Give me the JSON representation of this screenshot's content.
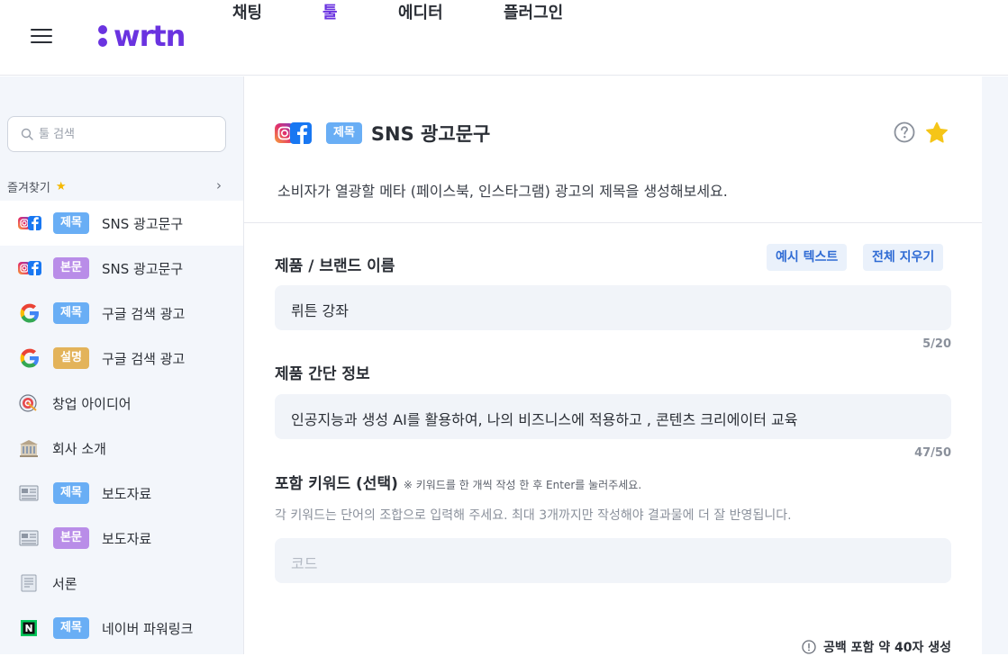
{
  "header": {
    "logo_text": "wrtn",
    "nav": [
      {
        "label": "채팅",
        "active": false
      },
      {
        "label": "툴",
        "active": true
      },
      {
        "label": "에디터",
        "active": false
      },
      {
        "label": "플러그인",
        "active": false
      }
    ]
  },
  "sidebar": {
    "search_placeholder": "툴 검색",
    "favorites_label": "즐겨찾기",
    "items": [
      {
        "icon": "instagram-facebook-icon",
        "badge": "제목",
        "badge_color": "#69aef5",
        "label": "SNS 광고문구",
        "selected": true
      },
      {
        "icon": "instagram-facebook-icon",
        "badge": "본문",
        "badge_color": "#b98de8",
        "label": "SNS 광고문구",
        "selected": false
      },
      {
        "icon": "google-icon",
        "badge": "제목",
        "badge_color": "#69aef5",
        "label": "구글 검색 광고",
        "selected": false
      },
      {
        "icon": "google-icon",
        "badge": "설명",
        "badge_color": "#e3b35a",
        "label": "구글 검색 광고",
        "selected": false
      },
      {
        "icon": "target-icon",
        "badge": "",
        "label": "창업 아이디어",
        "selected": false
      },
      {
        "icon": "building-icon",
        "badge": "",
        "label": "회사 소개",
        "selected": false
      },
      {
        "icon": "newspaper-icon",
        "badge": "제목",
        "badge_color": "#69aef5",
        "label": "보도자료",
        "selected": false
      },
      {
        "icon": "newspaper-icon",
        "badge": "본문",
        "badge_color": "#b98de8",
        "label": "보도자료",
        "selected": false
      },
      {
        "icon": "document-icon",
        "badge": "",
        "label": "서론",
        "selected": false
      },
      {
        "icon": "naver-icon",
        "badge": "제목",
        "badge_color": "#69aef5",
        "label": "네이버 파워링크",
        "selected": false
      }
    ]
  },
  "main": {
    "title_badge": "제목",
    "title": "SNS 광고문구",
    "description": "소비자가 열광할 메타 (페이스북, 인스타그램) 광고의 제목을 생성해보세요.",
    "example_button": "예시 텍스트",
    "clear_button": "전체 지우기",
    "fields": {
      "brand": {
        "label": "제품 / 브랜드 이름",
        "value": "뤼튼 강좌",
        "counter": "5/20"
      },
      "info": {
        "label": "제품 간단 정보",
        "value": "인공지능과 생성 AI를 활용하여, 나의 비즈니스에 적용하고 , 콘텐츠 크리에이터 교육",
        "counter": "47/50"
      },
      "keywords": {
        "label": "포함 키워드 (선택)",
        "note": "※ 키워드를 한 개씩 작성 한 후 Enter를 눌러주세요.",
        "help": "각 키워드는 단어의 조합으로 입력해 주세요. 최대 3개까지만 작성해야 결과물에 더 잘 반영됩니다.",
        "placeholder": "코드"
      }
    },
    "footer_note": "공백 포함 약 40자 생성"
  },
  "colors": {
    "brand": "#6a33e0",
    "badge_title": "#69aef5",
    "badge_body": "#b98de8",
    "badge_desc": "#e3b35a",
    "star": "#f5c518"
  }
}
